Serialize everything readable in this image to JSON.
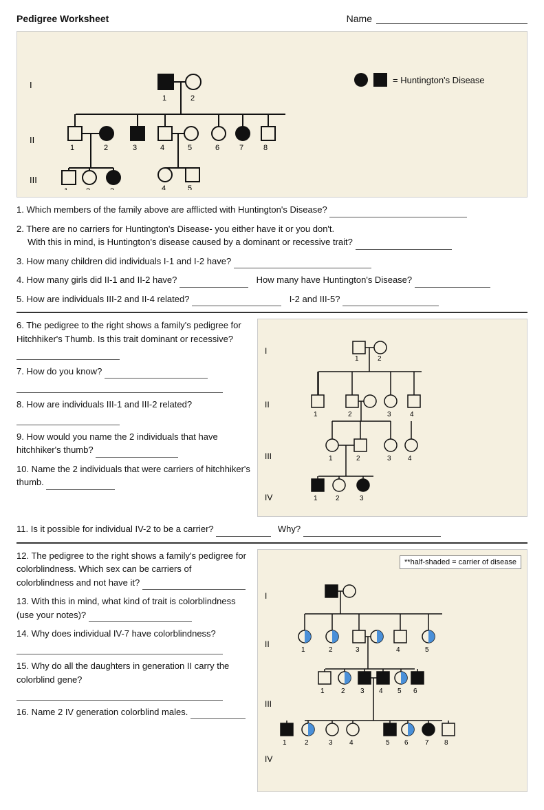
{
  "header": {
    "title": "Pedigree Worksheet",
    "name_label": "Name"
  },
  "legend": {
    "filled_circle_label": "= Huntington's Disease"
  },
  "questions": [
    {
      "id": "q1",
      "text": "1. Which members of the family above are afflicted with Huntington's Disease?"
    },
    {
      "id": "q2a",
      "text": "2. There are no carriers for Huntington's Disease- you either have it or you don't."
    },
    {
      "id": "q2b",
      "text": "With this in mind, is Huntington's disease caused by a dominant or recessive trait?"
    },
    {
      "id": "q3",
      "text": "3. How many children did individuals I-1 and I-2 have?"
    },
    {
      "id": "q4a",
      "text": "4. How many girls did II-1 and II-2 have?"
    },
    {
      "id": "q4b",
      "text": "How many have Huntington's Disease?"
    },
    {
      "id": "q5",
      "text": "5. How are individuals III-2 and II-4 related?"
    },
    {
      "id": "q5b",
      "text": "I-2 and III-5?"
    }
  ],
  "section2_questions": [
    {
      "id": "q6",
      "text": "6. The pedigree to the right shows a family's pedigree for Hitchhiker's Thumb. Is this trait dominant or recessive?"
    },
    {
      "id": "q7",
      "text": "7. How do you know?"
    },
    {
      "id": "q8",
      "text": "8. How are individuals III-1 and III-2 related?"
    },
    {
      "id": "q9",
      "text": "9. How would you name the 2 individuals that have hitchhiker's thumb?"
    },
    {
      "id": "q10",
      "text": "10. Name the 2 individuals that were carriers of hitchhiker's thumb."
    },
    {
      "id": "q11",
      "text": "11. Is it possible for individual IV-2 to be a carrier?"
    },
    {
      "id": "q11b",
      "text": "Why?"
    }
  ],
  "section3_questions": [
    {
      "id": "q12",
      "text": "12. The pedigree to the right shows a family's pedigree for colorblindness.  Which sex can be carriers of colorblindness and not have it?"
    },
    {
      "id": "q13",
      "text": "13. With this in mind, what kind of trait is colorblindness (use your notes)?"
    },
    {
      "id": "q14",
      "text": "14. Why does individual IV-7 have colorblindness?"
    },
    {
      "id": "q15",
      "text": "15. Why do all the daughters in generation II carry the colorblind gene?"
    },
    {
      "id": "q16",
      "text": "16. Name 2 IV generation colorblind males."
    }
  ],
  "colorblind_legend": {
    "text": "**half-shaded = carrier of disease"
  }
}
